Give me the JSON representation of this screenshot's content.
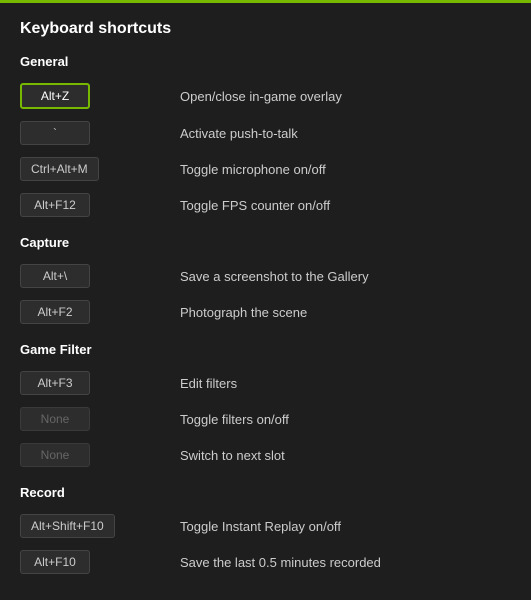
{
  "title": "Keyboard shortcuts",
  "sections": [
    {
      "name": "General",
      "items": [
        {
          "key": "Alt+Z",
          "action": "Open/close in-game overlay",
          "highlighted": true,
          "disabled": false
        },
        {
          "key": "`",
          "action": "Activate push-to-talk",
          "highlighted": false,
          "disabled": false
        },
        {
          "key": "Ctrl+Alt+M",
          "action": "Toggle microphone on/off",
          "highlighted": false,
          "disabled": false
        },
        {
          "key": "Alt+F12",
          "action": "Toggle FPS counter on/off",
          "highlighted": false,
          "disabled": false
        }
      ]
    },
    {
      "name": "Capture",
      "items": [
        {
          "key": "Alt+\\",
          "action": "Save a screenshot to the Gallery",
          "highlighted": false,
          "disabled": false
        },
        {
          "key": "Alt+F2",
          "action": "Photograph the scene",
          "highlighted": false,
          "disabled": false
        }
      ]
    },
    {
      "name": "Game Filter",
      "items": [
        {
          "key": "Alt+F3",
          "action": "Edit filters",
          "highlighted": false,
          "disabled": false
        },
        {
          "key": "None",
          "action": "Toggle filters on/off",
          "highlighted": false,
          "disabled": true
        },
        {
          "key": "None",
          "action": "Switch to next slot",
          "highlighted": false,
          "disabled": true
        }
      ]
    },
    {
      "name": "Record",
      "items": [
        {
          "key": "Alt+Shift+F10",
          "action": "Toggle Instant Replay on/off",
          "highlighted": false,
          "disabled": false
        },
        {
          "key": "Alt+F10",
          "action": "Save the last 0.5 minutes recorded",
          "highlighted": false,
          "disabled": false
        }
      ]
    }
  ]
}
